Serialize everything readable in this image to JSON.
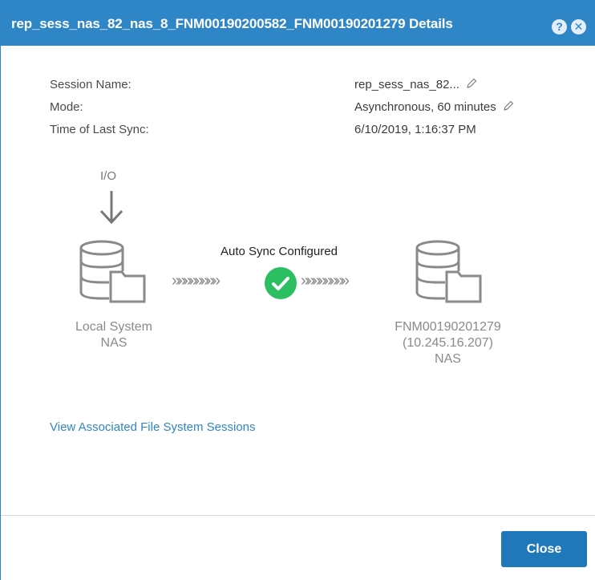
{
  "dialog": {
    "title": "rep_sess_nas_82_nas_8_FNM00190200582_FNM00190201279 Details",
    "help_icon": "?",
    "close_icon": "✕"
  },
  "details": {
    "session_name_label": "Session Name:",
    "session_name_value": "rep_sess_nas_82...",
    "mode_label": "Mode:",
    "mode_value": "Asynchronous, 60 minutes",
    "last_sync_label": "Time of Last Sync:",
    "last_sync_value": "6/10/2019, 1:16:37 PM"
  },
  "diagram": {
    "io_label": "I/O",
    "sync_status": "Auto Sync Configured",
    "chevrons_left": "»»»»»»»»",
    "chevrons_right": "»»»»»»»»",
    "local": {
      "line1": "Local System",
      "line2": "NAS"
    },
    "remote": {
      "line1": "FNM00190201279",
      "line2": "(10.245.16.207)",
      "line3": "NAS"
    }
  },
  "links": {
    "associated_sessions": "View Associated File System Sessions"
  },
  "footer": {
    "close_label": "Close"
  },
  "colors": {
    "accent": "#2f86c6",
    "success": "#2bbf62",
    "button": "#1f78b9"
  }
}
